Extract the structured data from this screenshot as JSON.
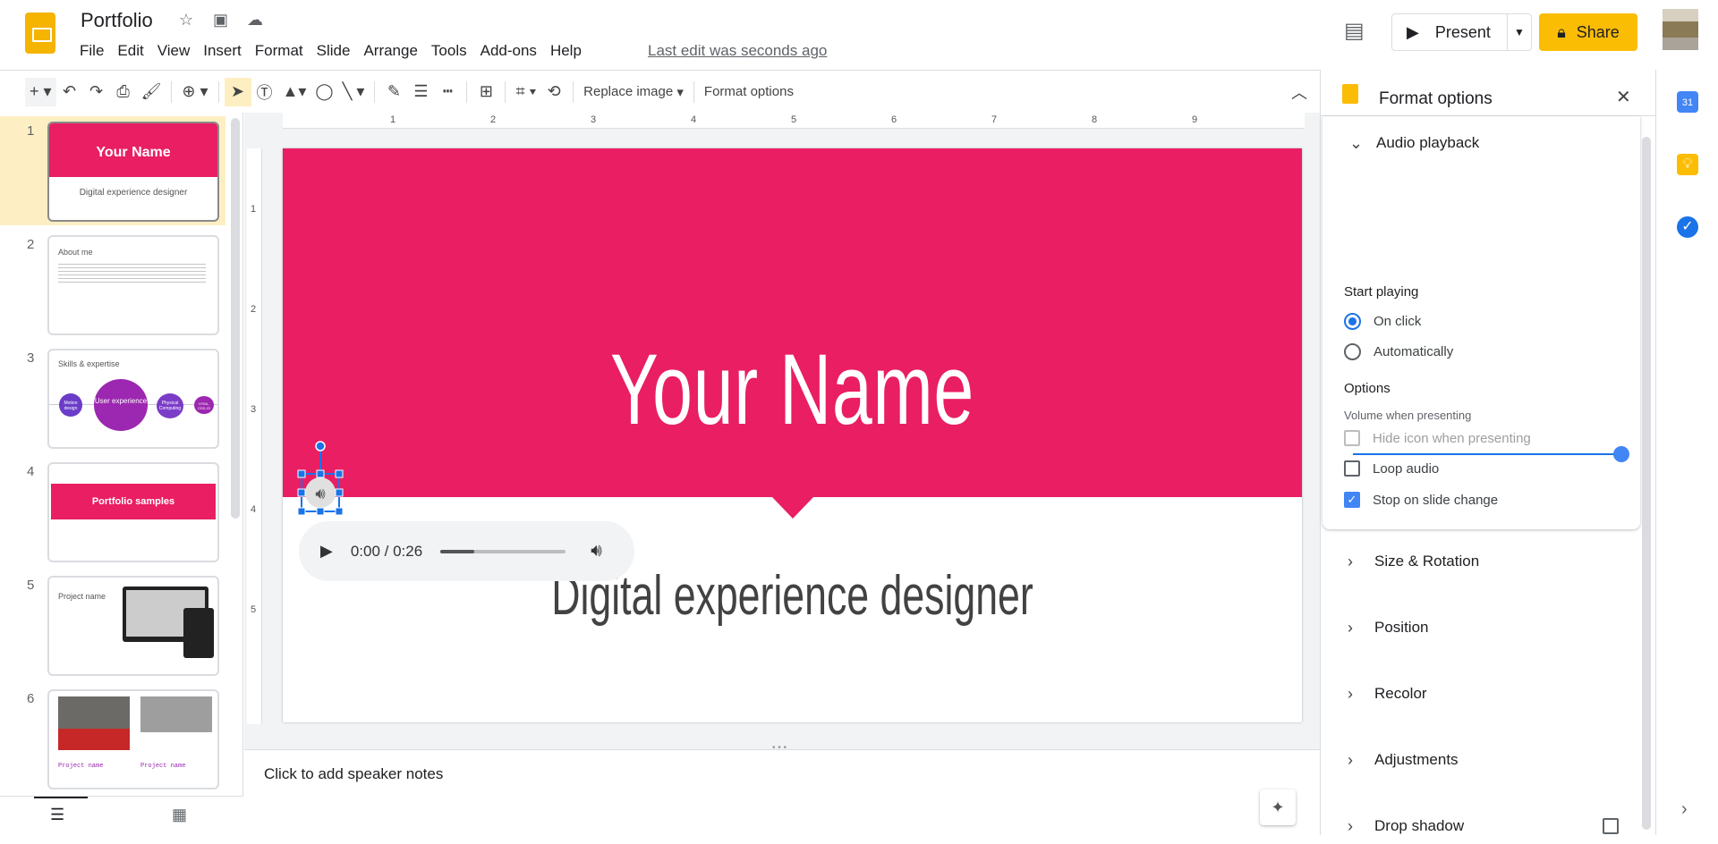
{
  "header": {
    "title": "Portfolio",
    "menu": [
      "File",
      "Edit",
      "View",
      "Insert",
      "Format",
      "Slide",
      "Arrange",
      "Tools",
      "Add-ons",
      "Help"
    ],
    "last_edit": "Last edit was seconds ago",
    "present_label": "Present",
    "share_label": "Share"
  },
  "toolbar": {
    "replace_image": "Replace image",
    "format_options": "Format options"
  },
  "filmstrip": {
    "slides": [
      {
        "num": "1",
        "title": "Your Name",
        "subtitle": "Digital experience designer"
      },
      {
        "num": "2",
        "title": "About me"
      },
      {
        "num": "3",
        "title": "Skills & expertise",
        "bubbles": [
          "Motion design",
          "User experience",
          "Physical Computing",
          "HTML, CSS,JS"
        ]
      },
      {
        "num": "4",
        "title": "Portfolio samples"
      },
      {
        "num": "5",
        "title": "Project name"
      },
      {
        "num": "6",
        "captions": [
          "Project name",
          "Project name"
        ]
      }
    ]
  },
  "ruler": {
    "h": [
      "1",
      "2",
      "3",
      "4",
      "5",
      "6",
      "7",
      "8",
      "9"
    ],
    "v": [
      "1",
      "2",
      "3",
      "4",
      "5"
    ]
  },
  "slide": {
    "title": "Your Name",
    "subtitle": "Digital experience designer",
    "accent": "#e91e63",
    "audio": {
      "time": "0:00 / 0:26",
      "progress_fraction": 0.27
    }
  },
  "notes": {
    "placeholder": "Click to add speaker notes"
  },
  "format_panel": {
    "title": "Format options",
    "audio_section": "Audio playback",
    "start_playing": "Start playing",
    "radios": [
      {
        "label": "On click",
        "selected": true
      },
      {
        "label": "Automatically",
        "selected": false
      }
    ],
    "options_label": "Options",
    "volume_label": "Volume when presenting",
    "volume_fraction": 1.0,
    "checkboxes": [
      {
        "label": "Hide icon when presenting",
        "checked": false,
        "disabled": true
      },
      {
        "label": "Loop audio",
        "checked": false
      },
      {
        "label": "Stop on slide change",
        "checked": true
      }
    ],
    "sections": [
      "Size & Rotation",
      "Position",
      "Recolor",
      "Adjustments",
      "Drop shadow"
    ]
  }
}
